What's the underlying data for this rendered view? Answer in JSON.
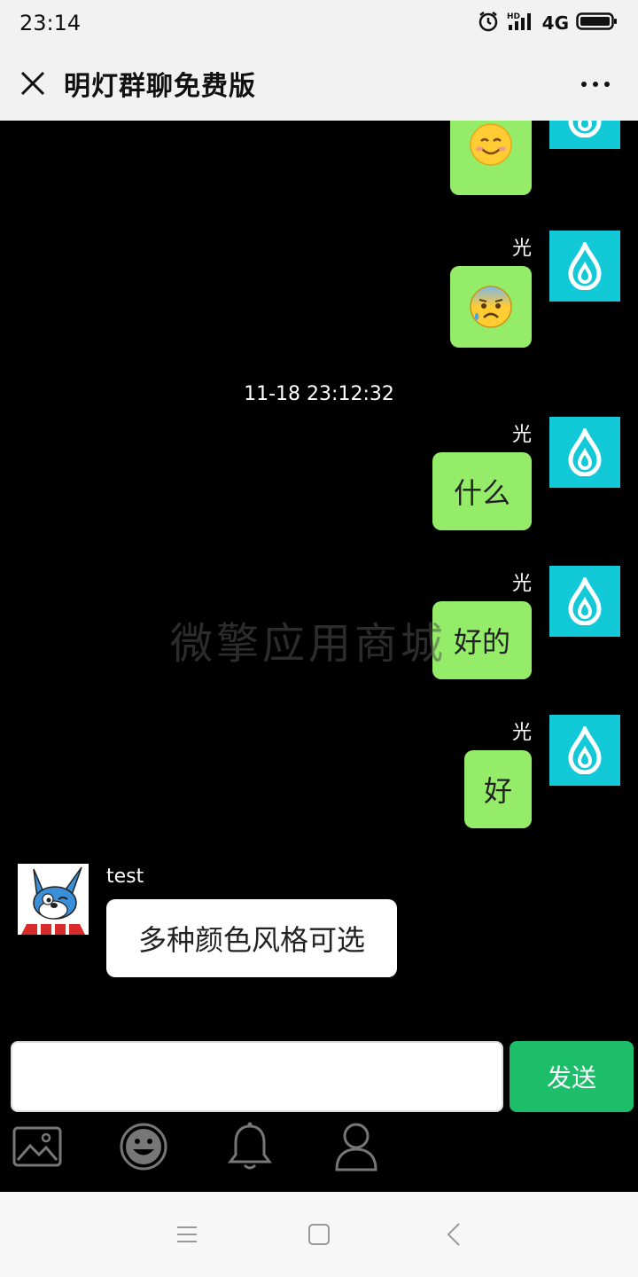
{
  "status_bar": {
    "time": "23:14",
    "network": "4G",
    "hd": "HD"
  },
  "header": {
    "title": "明灯群聊免费版"
  },
  "watermark": "微擎应用商城",
  "messages": [
    {
      "side": "right",
      "emoji": "smiling-face"
    },
    {
      "side": "right",
      "sender": "光",
      "emoji": "anxious-sweat-face"
    },
    {
      "timestamp": "11-18 23:12:32"
    },
    {
      "side": "right",
      "sender": "光",
      "text": "什么"
    },
    {
      "side": "right",
      "sender": "光",
      "text": "好的"
    },
    {
      "side": "right",
      "sender": "光",
      "text": "好"
    },
    {
      "side": "left",
      "sender": "test",
      "text": "多种颜色风格可选"
    }
  ],
  "input": {
    "value": "",
    "placeholder": ""
  },
  "send_label": "发送",
  "toolbar_icons": [
    "image-icon",
    "emoji-icon",
    "bell-icon",
    "user-icon"
  ],
  "colors": {
    "my_bubble": "#95ec69",
    "other_bubble": "#ffffff",
    "fire_avatar": "#12c9d7",
    "send_button": "#1dbe6a"
  }
}
